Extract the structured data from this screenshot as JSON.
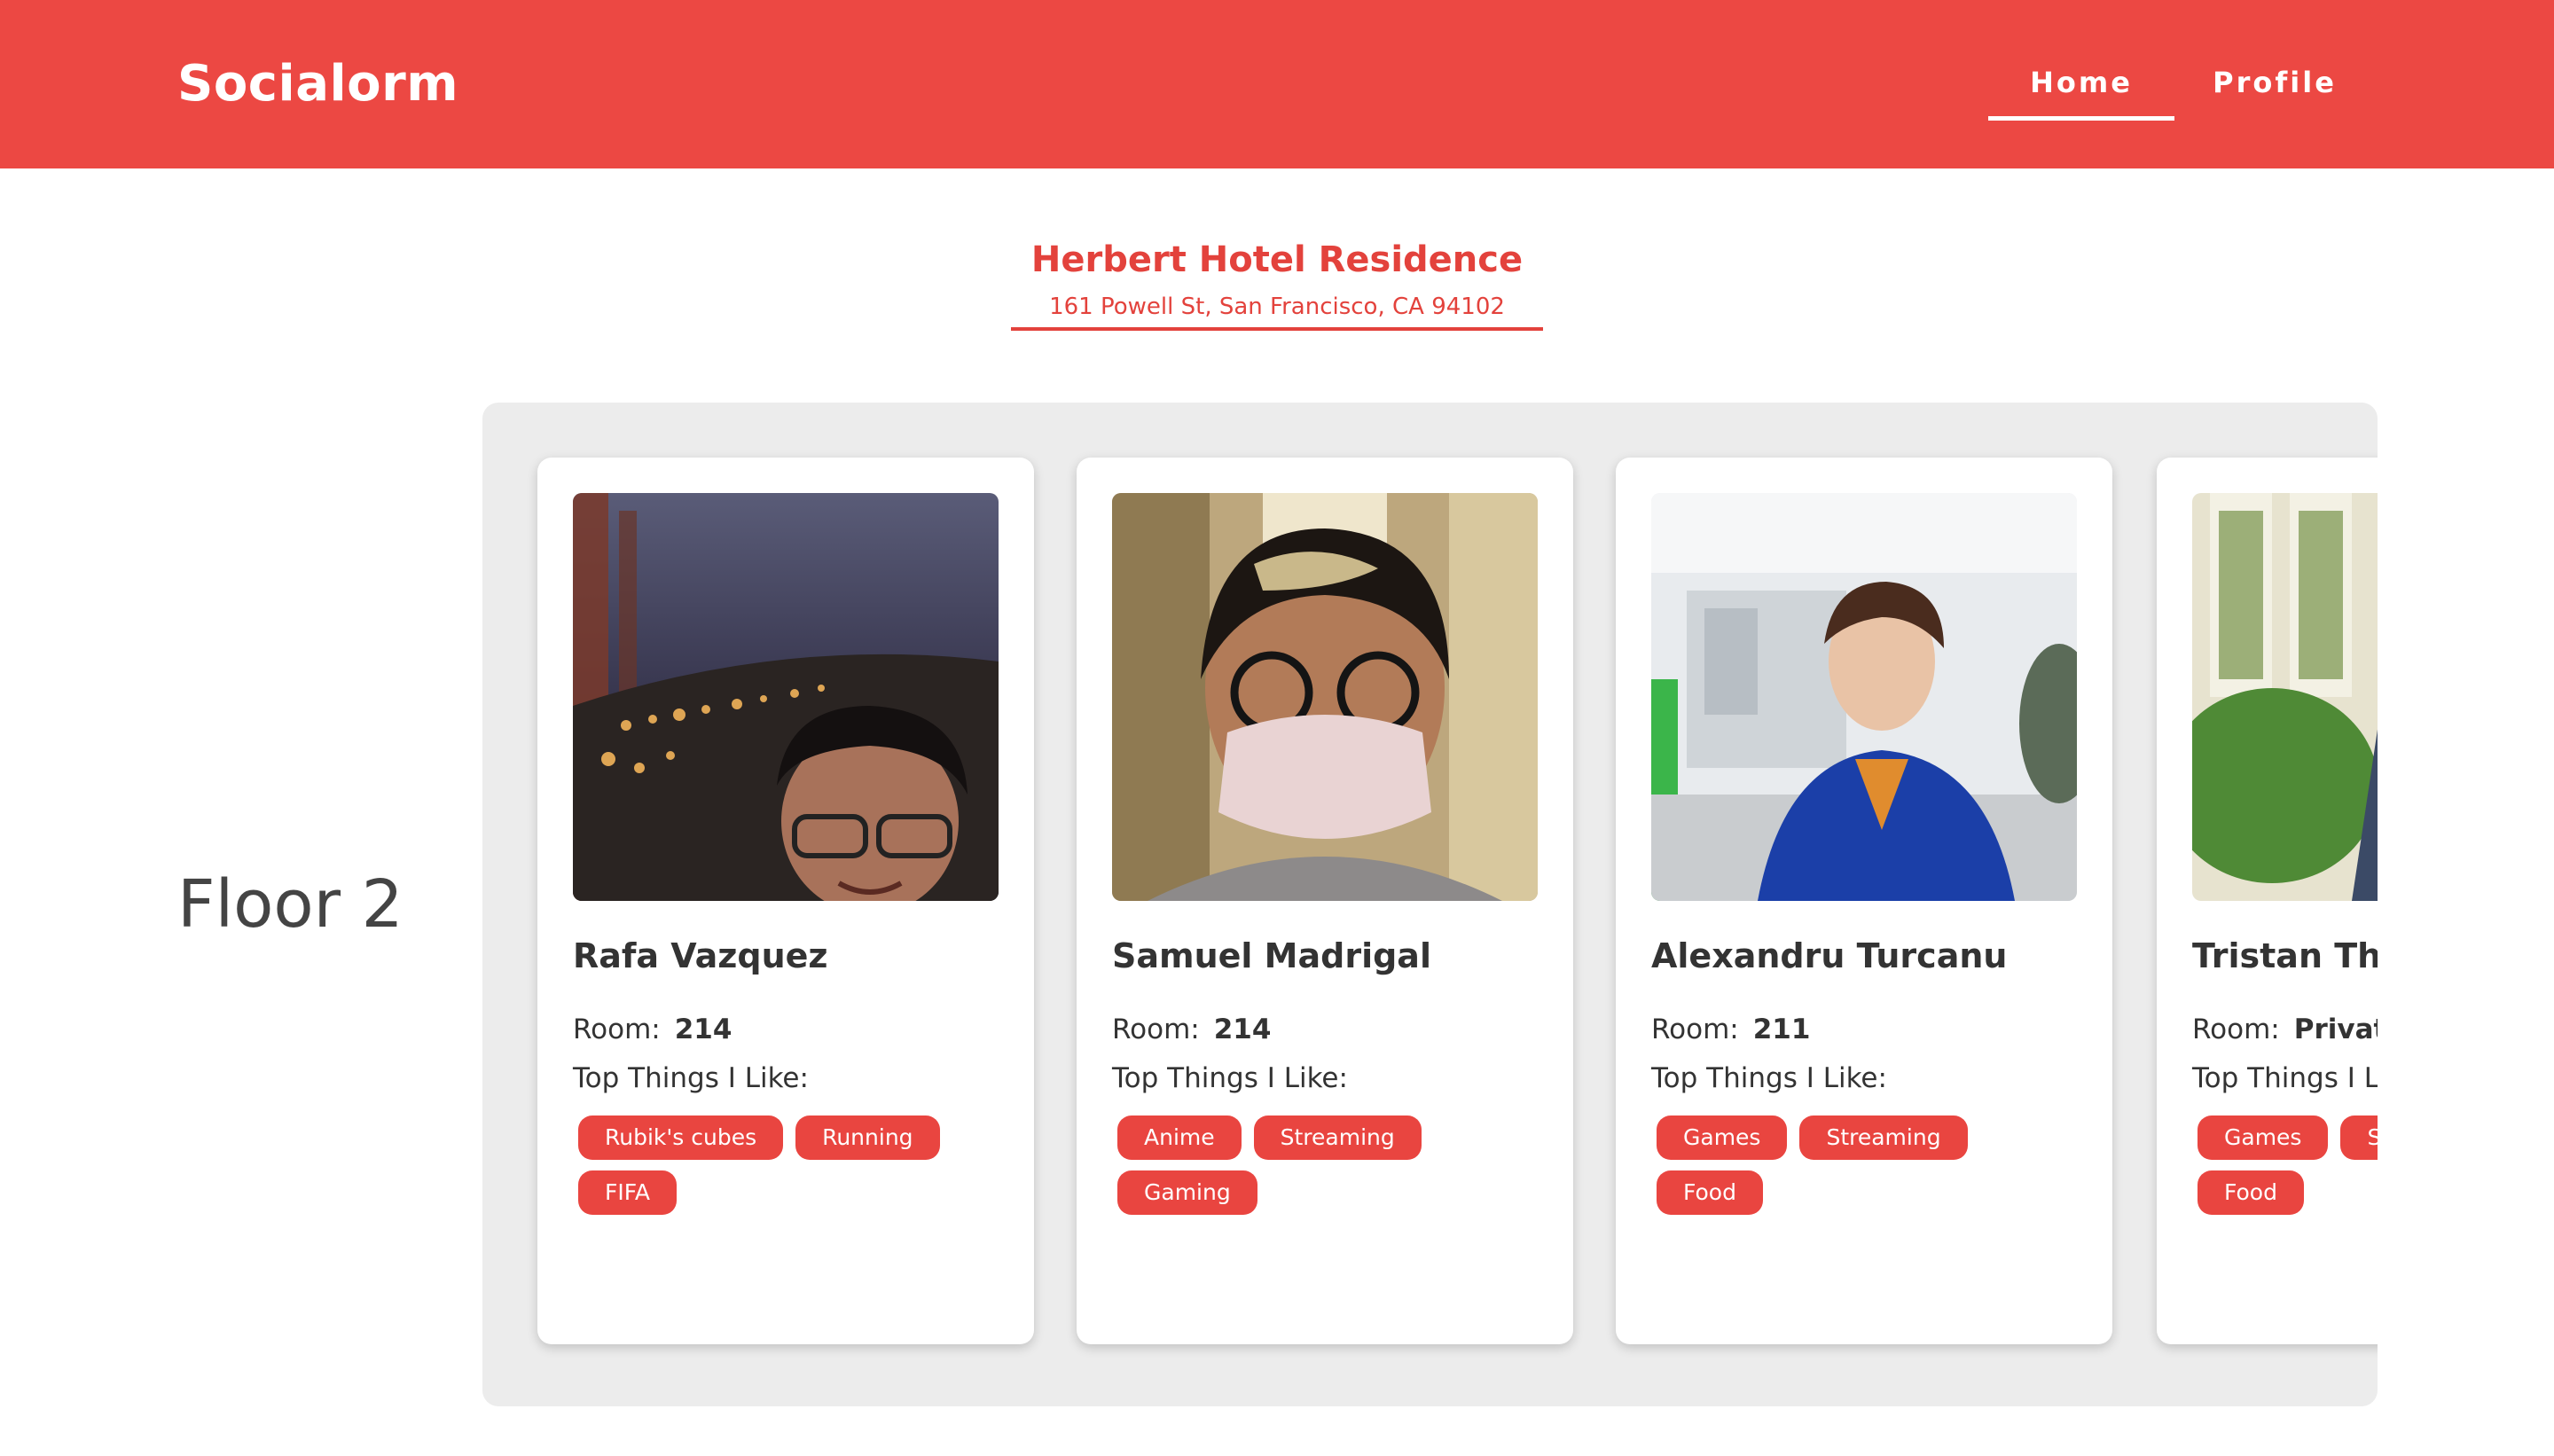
{
  "app": {
    "brand": "Socialorm"
  },
  "nav": {
    "home": "Home",
    "profile": "Profile"
  },
  "hotel": {
    "name": "Herbert Hotel Residence",
    "address": "161 Powell St, San Francisco, CA 94102"
  },
  "floor": {
    "label": "Floor 2"
  },
  "labels": {
    "room": "Room:",
    "likes": "Top Things I Like:"
  },
  "residents": [
    {
      "name": "Rafa Vazquez",
      "room": "214",
      "likes": [
        "Rubik's cubes",
        "Running",
        "FIFA"
      ]
    },
    {
      "name": "Samuel Madrigal",
      "room": "214",
      "likes": [
        "Anime",
        "Streaming",
        "Gaming"
      ]
    },
    {
      "name": "Alexandru Turcanu",
      "room": "211",
      "likes": [
        "Games",
        "Streaming",
        "Food"
      ]
    },
    {
      "name": "Tristan Thompson",
      "room": "Private",
      "likes": [
        "Games",
        "Streaming",
        "Food"
      ]
    }
  ],
  "colors": {
    "brand": "#ec4843",
    "tag": "#e94540",
    "strip": "#ececec"
  }
}
